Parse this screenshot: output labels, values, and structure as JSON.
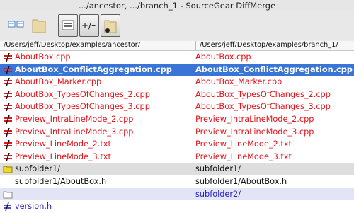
{
  "window": {
    "title": ".../ancestor, .../branch_1 - SourceGear DiffMerge"
  },
  "toolbar": {
    "buttons": [
      {
        "name": "compare-files-icon"
      },
      {
        "name": "folder-icon"
      },
      {
        "name": "show-equal-icon"
      },
      {
        "name": "add-remove-icon"
      },
      {
        "name": "folder-peer-icon"
      }
    ]
  },
  "columns": {
    "left_path": "/Users/jeff/Desktop/examples/ancestor/",
    "right_path": "/Users/jeff/Desktop/examples/branch_1/"
  },
  "rows": [
    {
      "kind": "diff",
      "icon": "not-equal-icon",
      "left": "AboutBox.cpp",
      "right": "AboutBox.cpp"
    },
    {
      "kind": "sel",
      "icon": "not-equal-icon",
      "left": "AboutBox_ConflictAggregation.cpp",
      "right": "AboutBox_ConflictAggregation.cpp"
    },
    {
      "kind": "diff",
      "icon": "not-equal-icon",
      "left": "AboutBox_Marker.cpp",
      "right": "AboutBox_Marker.cpp"
    },
    {
      "kind": "diff",
      "icon": "not-equal-icon",
      "left": "AboutBox_TypesOfChanges_2.cpp",
      "right": "AboutBox_TypesOfChanges_2.cpp"
    },
    {
      "kind": "diff",
      "icon": "not-equal-icon",
      "left": "AboutBox_TypesOfChanges_3.cpp",
      "right": "AboutBox_TypesOfChanges_3.cpp"
    },
    {
      "kind": "diff",
      "icon": "not-equal-icon",
      "left": "Preview_IntraLineMode_2.cpp",
      "right": "Preview_IntraLineMode_2.cpp"
    },
    {
      "kind": "diff",
      "icon": "not-equal-icon",
      "left": "Preview_IntraLineMode_3.cpp",
      "right": "Preview_IntraLineMode_3.cpp"
    },
    {
      "kind": "diff",
      "icon": "not-equal-icon",
      "left": "Preview_LineMode_2.txt",
      "right": "Preview_LineMode_2.txt"
    },
    {
      "kind": "diff",
      "icon": "not-equal-icon",
      "left": "Preview_LineMode_3.txt",
      "right": "Preview_LineMode_3.txt"
    },
    {
      "kind": "folder",
      "icon": "yellow-folder-icon",
      "left": "subfolder1/",
      "right": "subfolder1/"
    },
    {
      "kind": "plain",
      "icon": "",
      "left": "subfolder1/AboutBox.h",
      "right": "subfolder1/AboutBox.h"
    },
    {
      "kind": "lav",
      "icon": "empty-folder-icon",
      "left": "",
      "right": "subfolder2/"
    },
    {
      "kind": "last",
      "icon": "file-diff-icon",
      "left": "version.h",
      "right": ""
    }
  ],
  "colors": {
    "diff": "#e4141c",
    "selection": "#3875d7",
    "peer": "#2a22c8"
  }
}
